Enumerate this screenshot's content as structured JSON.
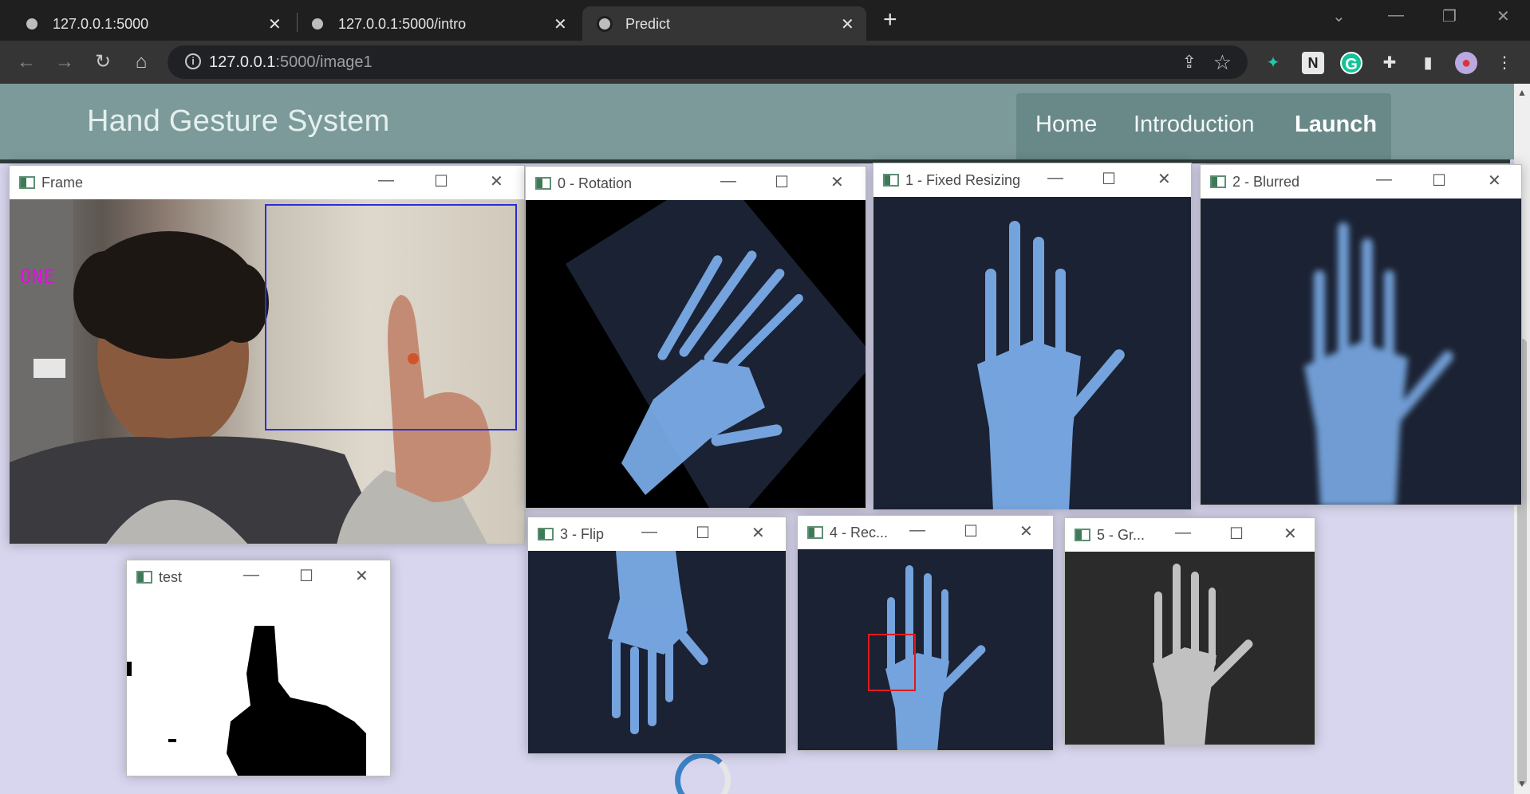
{
  "browser": {
    "tabs": [
      {
        "title": "127.0.0.1:5000",
        "active": false
      },
      {
        "title": "127.0.0.1:5000/intro",
        "active": false
      },
      {
        "title": "Predict",
        "active": true
      }
    ],
    "url_host": "127.0.0.1",
    "url_path": ":5000/image1"
  },
  "page": {
    "brand": "Hand Gesture System",
    "nav": [
      "Home",
      "Introduction",
      "Launch"
    ]
  },
  "windows": {
    "frame": {
      "title": "Frame",
      "overlay_text": "ONE"
    },
    "rotation": {
      "title": "0 - Rotation"
    },
    "fixed_resizing": {
      "title": "1 - Fixed Resizing"
    },
    "blurred": {
      "title": "2 - Blurred"
    },
    "flip": {
      "title": "3 - Flip"
    },
    "rec": {
      "title": "4 - Rec..."
    },
    "gray": {
      "title": "5 - Gr..."
    },
    "test": {
      "title": "test"
    }
  },
  "colors": {
    "navbar": "#7d9a9a",
    "page_bg": "#d8d6ee",
    "xray_bg": "#1b2233",
    "bone": "#7fb2f0",
    "overlay_text": "#e20fe0",
    "bbox": "#2a2fd8",
    "rec_box": "#e01b1b"
  }
}
